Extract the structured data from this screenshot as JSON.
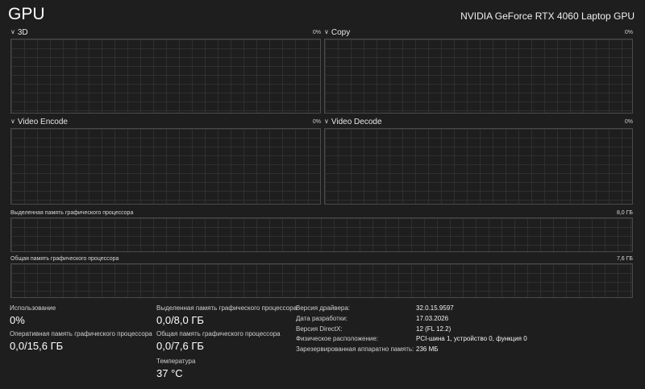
{
  "header": {
    "title": "GPU",
    "gpu_name": "NVIDIA GeForce RTX 4060 Laptop GPU"
  },
  "engines": [
    {
      "name": "3D",
      "percent": "0%"
    },
    {
      "name": "Copy",
      "percent": "0%"
    },
    {
      "name": "Video Encode",
      "percent": "0%"
    },
    {
      "name": "Video Decode",
      "percent": "0%"
    }
  ],
  "memory_graphs": {
    "dedicated": {
      "label": "Выделенная память графического процессора",
      "max": "8,0 ГБ"
    },
    "shared": {
      "label": "Общая память графического процессора",
      "max": "7,6 ГБ"
    }
  },
  "stats": {
    "utilization": {
      "label": "Использование",
      "value": "0%"
    },
    "gpu_memory": {
      "label": "Оперативная память графического процессора",
      "value": "0,0/15,6 ГБ"
    },
    "dedicated_memory": {
      "label": "Выделенная память графического процессора",
      "value": "0,0/8,0 ГБ"
    },
    "shared_memory": {
      "label": "Общая память графического процессора",
      "value": "0,0/7,6 ГБ"
    },
    "temperature": {
      "label": "Температура",
      "value": "37 °C"
    }
  },
  "details": [
    {
      "key": "Версия драйвера:",
      "value": "32.0.15.9597"
    },
    {
      "key": "Дата разработки:",
      "value": "17.03.2026"
    },
    {
      "key": "Версия DirectX:",
      "value": "12 (FL 12.2)"
    },
    {
      "key": "Физическое расположение:",
      "value": "PCI-шина 1, устройство 0, функция 0"
    },
    {
      "key": "Зарезервированная аппаратно память:",
      "value": "236 МБ"
    }
  ],
  "icons": {
    "collapse": "chevron-down-icon"
  },
  "colors": {
    "background": "#1e1e1e",
    "graph_border": "#4a4a4a",
    "grid": "#2f2f2f"
  }
}
